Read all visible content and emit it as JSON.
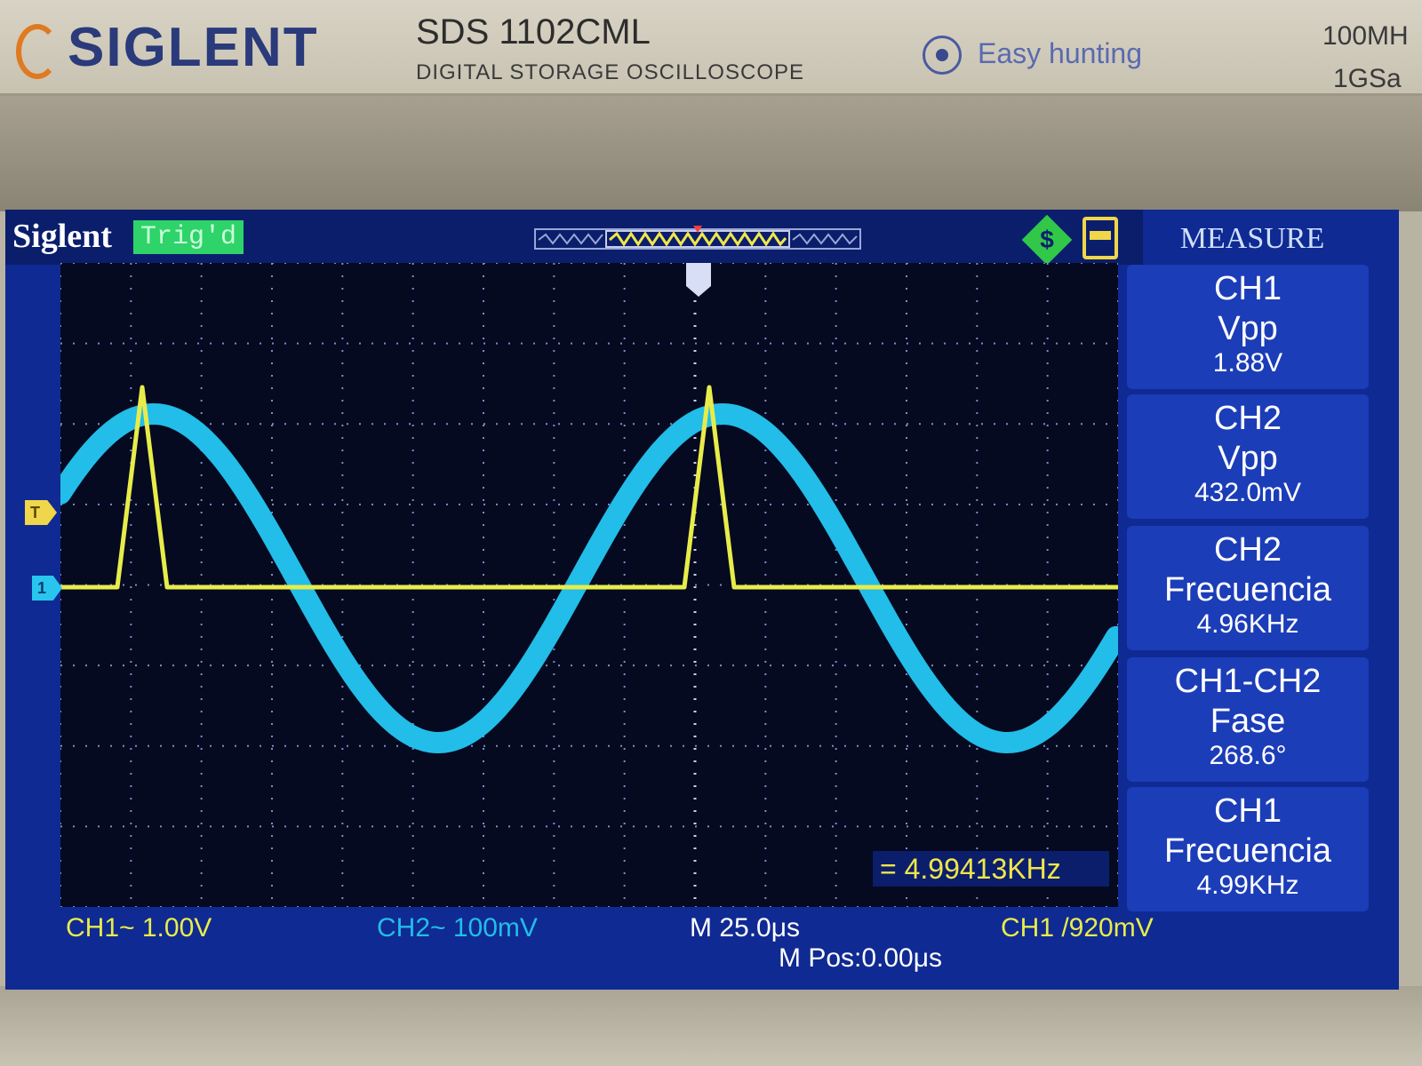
{
  "device": {
    "brand": "SIGLENT",
    "model": "SDS 1102CML",
    "subtitle": "DIGITAL STORAGE OSCILLOSCOPE",
    "feature": "Easy hunting",
    "spec_bandwidth": "100MH",
    "spec_samplerate": "1GSa"
  },
  "screen": {
    "logo": "Siglent",
    "trigger_status": "Trig'd",
    "trigger_marker": "T",
    "channel_marker": "1",
    "usb_label": "$"
  },
  "measure": {
    "title": "MEASURE",
    "items": [
      {
        "channel": "CH1",
        "name": "Vpp",
        "value": "1.88V"
      },
      {
        "channel": "CH2",
        "name": "Vpp",
        "value": "432.0mV"
      },
      {
        "channel": "CH2",
        "name": "Frecuencia",
        "value": "4.96KHz"
      },
      {
        "channel": "CH1-CH2",
        "name": "Fase",
        "value": "268.6°"
      },
      {
        "channel": "CH1",
        "name": "Frecuencia",
        "value": "4.99KHz"
      }
    ]
  },
  "readouts": {
    "ch1": "CH1~ 1.00V",
    "ch2": "CH2~ 100mV",
    "timebase": "M 25.0μs",
    "trigger": "CH1 /920mV",
    "mpos": "M Pos:0.00μs",
    "freq": "= 4.99413KHz"
  },
  "colors": {
    "ch1": "#e8ec4a",
    "ch2": "#22bde8",
    "screen_bg": "#050a20",
    "panel": "#1c3db8"
  }
}
